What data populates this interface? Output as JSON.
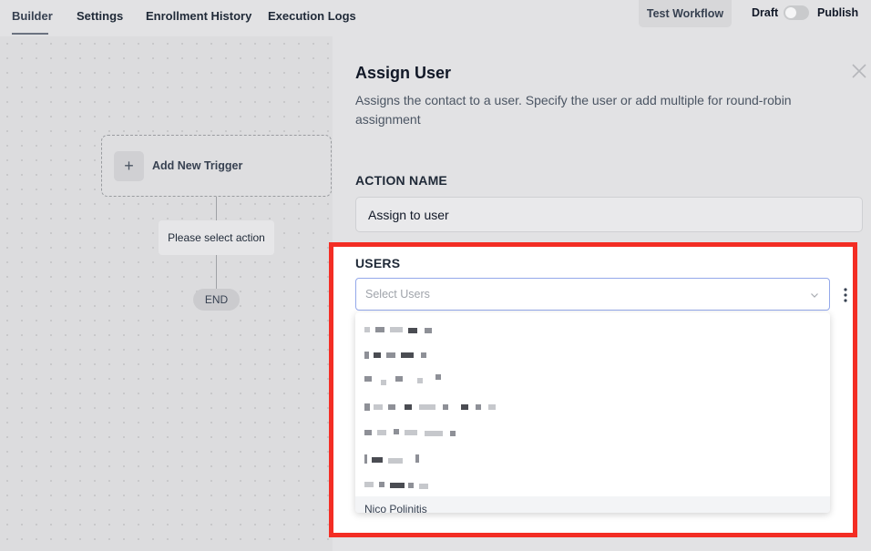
{
  "topbar": {
    "tabs": [
      {
        "label": "Builder"
      },
      {
        "label": "Settings"
      },
      {
        "label": "Enrollment History"
      },
      {
        "label": "Execution Logs"
      }
    ],
    "test_label": "Test Workflow",
    "draft_label": "Draft",
    "publish_label": "Publish"
  },
  "canvas": {
    "trigger_label": "Add New Trigger",
    "plus_glyph": "+",
    "select_action": "Please select action",
    "end_label": "END"
  },
  "panel": {
    "title": "Assign User",
    "description": "Assigns the contact to a user. Specify the user or add multiple for round-robin assignment",
    "action_name_label": "ACTION NAME",
    "action_name_value": "Assign to user",
    "users_label": "USERS",
    "users_placeholder": "Select Users",
    "last_visible_option": "Nico Polinitis"
  },
  "colors": {
    "highlight": "#f32d24",
    "focus_border": "#93a8ea"
  },
  "icons": [
    "close-icon",
    "chevron-down-icon",
    "kebab-menu-icon",
    "plus-icon"
  ]
}
